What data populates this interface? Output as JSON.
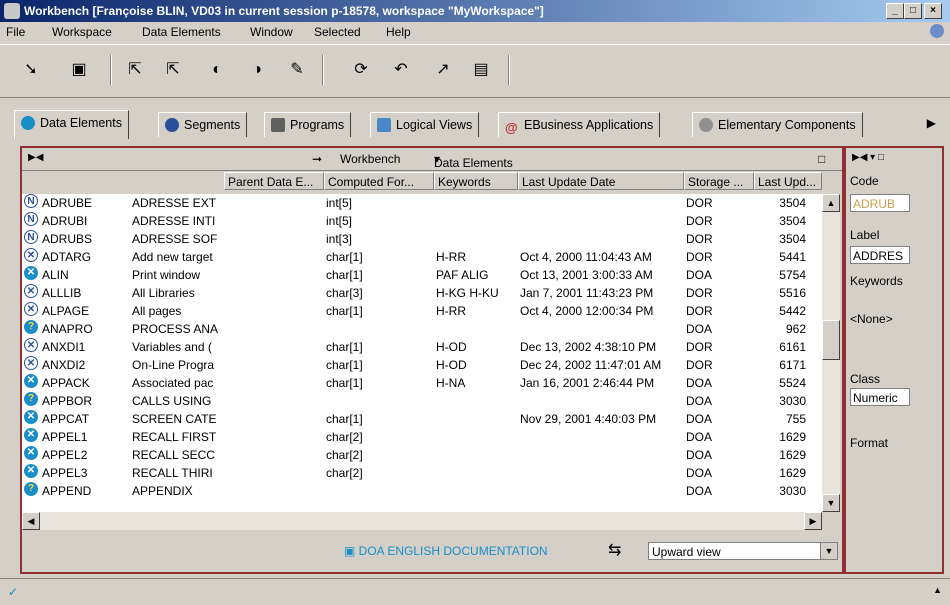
{
  "window": {
    "title": "Workbench [Françoise BLIN, VD03 in current session p-18578, workspace \"MyWorkspace\"]"
  },
  "menu": [
    "File",
    "Workspace",
    "Data Elements",
    "Window",
    "Selected",
    "Help"
  ],
  "tabs": [
    "Data Elements",
    "Segments",
    "Programs",
    "Logical Views",
    "EBusiness Applications",
    "Elementary Components"
  ],
  "list": {
    "header": {
      "workbench": "Workbench",
      "dropdown": "Data Elements"
    },
    "columns": [
      "Parent Data E...",
      "Computed For...",
      "Keywords",
      "Last Update Date",
      "Storage ...",
      "Last Upd..."
    ],
    "rows": [
      {
        "icon": "N",
        "code": "ADRUBE",
        "label": "ADRESSE EXT",
        "computed": "int[5]",
        "keywords": "",
        "date": "",
        "storage": "DOR",
        "last": "3504"
      },
      {
        "icon": "N",
        "code": "ADRUBI",
        "label": "ADRESSE INTI",
        "computed": "int[5]",
        "keywords": "",
        "date": "",
        "storage": "DOR",
        "last": "3504"
      },
      {
        "icon": "N",
        "code": "ADRUBS",
        "label": "ADRESSE SOF",
        "computed": "int[3]",
        "keywords": "",
        "date": "",
        "storage": "DOR",
        "last": "3504"
      },
      {
        "icon": "X",
        "code": "ADTARG",
        "label": "Add new target",
        "computed": "char[1]",
        "keywords": "H-RR",
        "date": "Oct 4, 2000 11:04:43 AM",
        "storage": "DOR",
        "last": "5441"
      },
      {
        "icon": "XF",
        "code": "ALIN",
        "label": "Print window",
        "computed": "char[1]",
        "keywords": "PAF ALIG",
        "date": "Oct 13, 2001 3:00:33 AM",
        "storage": "DOA",
        "last": "5754"
      },
      {
        "icon": "X",
        "code": "ALLLIB",
        "label": "All Libraries",
        "computed": "char[3]",
        "keywords": "H-KG H-KU",
        "date": "Jan 7, 2001 11:43:23 PM",
        "storage": "DOR",
        "last": "5516"
      },
      {
        "icon": "X",
        "code": "ALPAGE",
        "label": "All pages",
        "computed": "char[1]",
        "keywords": "H-RR",
        "date": "Oct 4, 2000 12:00:34 PM",
        "storage": "DOR",
        "last": "5442"
      },
      {
        "icon": "Q",
        "code": "ANAPRO",
        "label": "PROCESS ANA",
        "computed": "",
        "keywords": "",
        "date": "",
        "storage": "DOA",
        "last": "962"
      },
      {
        "icon": "X",
        "code": "ANXDI1",
        "label": "Variables and (",
        "computed": "char[1]",
        "keywords": "H-OD",
        "date": "Dec 13, 2002 4:38:10 PM",
        "storage": "DOR",
        "last": "6161"
      },
      {
        "icon": "X",
        "code": "ANXDI2",
        "label": "On-Line Progra",
        "computed": "char[1]",
        "keywords": "H-OD",
        "date": "Dec 24, 2002 11:47:01 AM",
        "storage": "DOR",
        "last": "6171"
      },
      {
        "icon": "XF",
        "code": "APPACK",
        "label": "Associated pac",
        "computed": "char[1]",
        "keywords": "H-NA",
        "date": "Jan 16, 2001 2:46:44 PM",
        "storage": "DOA",
        "last": "5524"
      },
      {
        "icon": "Q",
        "code": "APPBOR",
        "label": "CALLS USING",
        "computed": "",
        "keywords": "",
        "date": "",
        "storage": "DOA",
        "last": "3030"
      },
      {
        "icon": "XF",
        "code": "APPCAT",
        "label": "SCREEN CATE",
        "computed": "char[1]",
        "keywords": "",
        "date": "Nov 29, 2001 4:40:03 PM",
        "storage": "DOA",
        "last": "755"
      },
      {
        "icon": "XF",
        "code": "APPEL1",
        "label": "RECALL FIRST",
        "computed": "char[2]",
        "keywords": "",
        "date": "",
        "storage": "DOA",
        "last": "1629"
      },
      {
        "icon": "XF",
        "code": "APPEL2",
        "label": "RECALL SECC",
        "computed": "char[2]",
        "keywords": "",
        "date": "",
        "storage": "DOA",
        "last": "1629"
      },
      {
        "icon": "XF",
        "code": "APPEL3",
        "label": "RECALL THIRI",
        "computed": "char[2]",
        "keywords": "",
        "date": "",
        "storage": "DOA",
        "last": "1629"
      },
      {
        "icon": "Q",
        "code": "APPEND",
        "label": "APPENDIX",
        "computed": "",
        "keywords": "",
        "date": "",
        "storage": "DOA",
        "last": "3030"
      }
    ],
    "footer": {
      "library": "DOA ENGLISH DOCUMENTATION",
      "view": "Upward view"
    }
  },
  "detail": {
    "code_label": "Code",
    "code_value": "ADRUB",
    "label_label": "Label",
    "label_value": "ADDRES",
    "keywords_label": "Keywords",
    "keywords_value": "<None>",
    "class_label": "Class",
    "class_value": "Numeric",
    "format_label": "Format"
  }
}
